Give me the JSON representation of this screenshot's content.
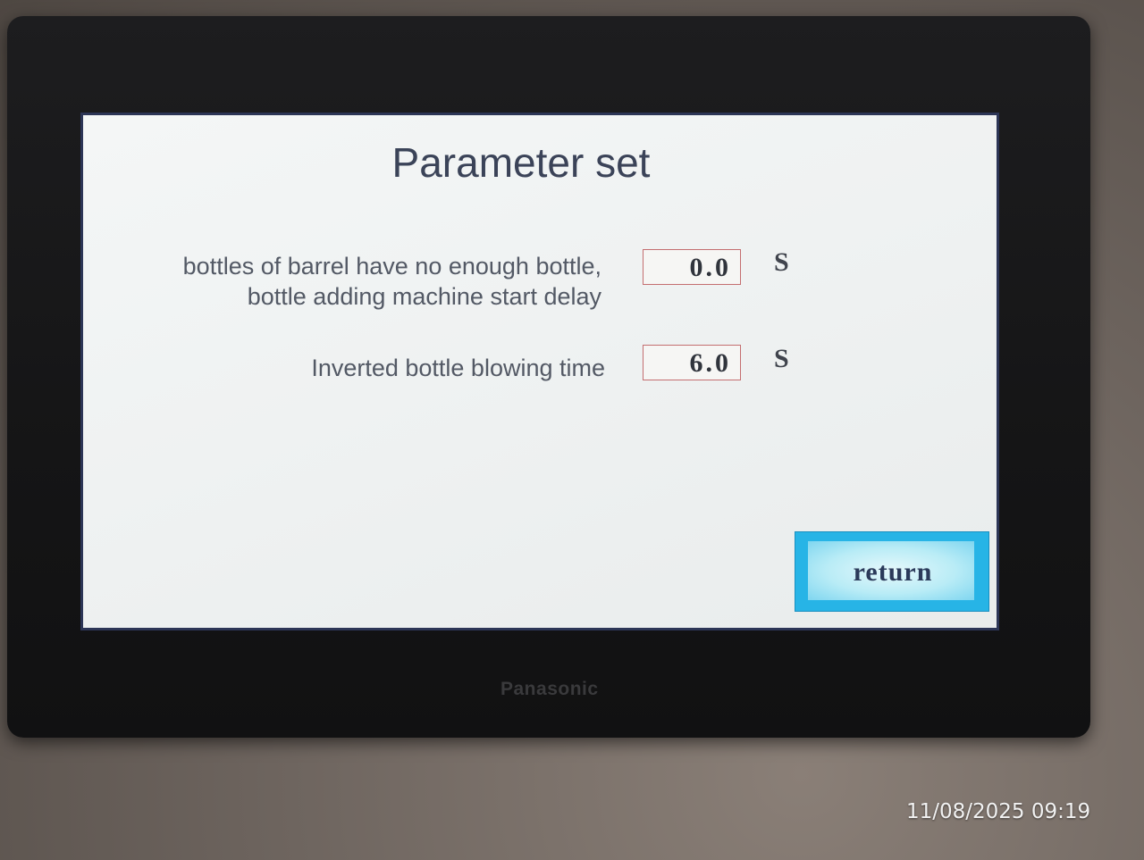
{
  "screen": {
    "title": "Parameter set",
    "parameters": [
      {
        "label_line1": "bottles of barrel have no enough bottle,",
        "label_line2": "bottle adding machine start delay",
        "value": "0.0",
        "unit": "S"
      },
      {
        "label_line1": "Inverted bottle blowing time",
        "value": "6.0",
        "unit": "S"
      }
    ],
    "return_label": "return"
  },
  "device": {
    "brand": "Panasonic"
  },
  "photo": {
    "timestamp": "11/08/2025 09:19"
  },
  "colors": {
    "screen_background": "#eef1f1",
    "text": "#535965",
    "value_border": "#c46e70",
    "return_button": "#27b4e6"
  }
}
